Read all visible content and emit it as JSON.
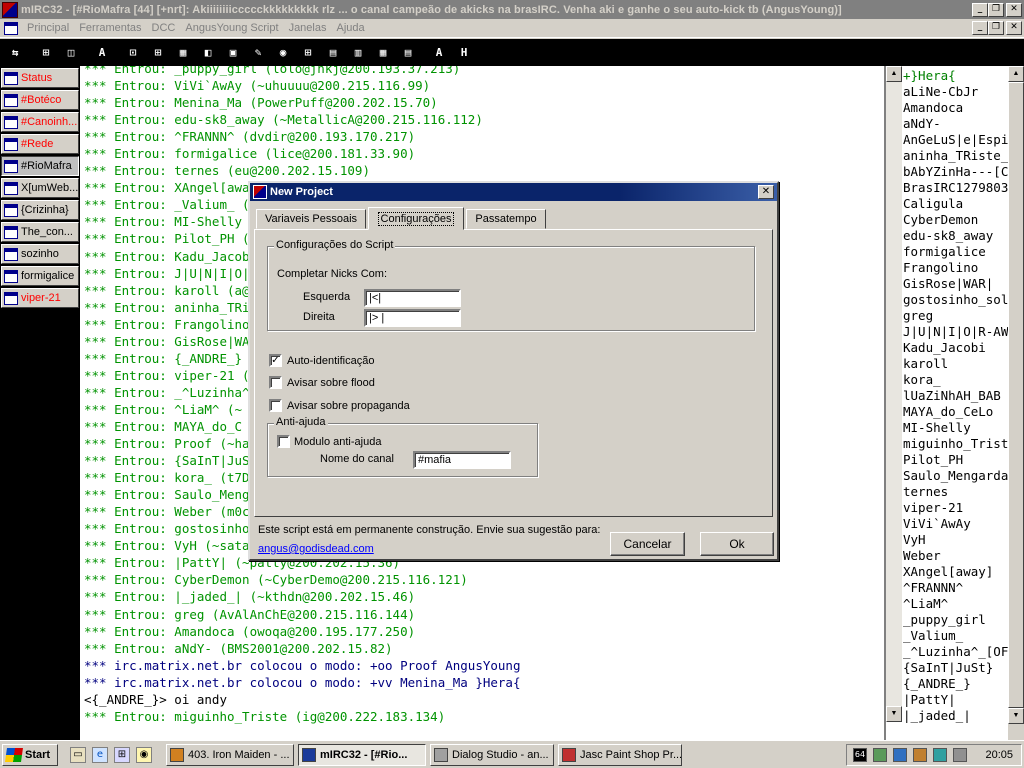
{
  "window": {
    "title": "mIRC32 - [#RioMafra [44] [+nrt]: Akiiiiiiiiccccckkkkkkkkk rlz ... o canal campeão de akicks na brasIRC. Venha aki e ganhe o seu auto-kick tb (AngusYoung)]"
  },
  "menu": {
    "items": [
      "Principal",
      "Ferramentas",
      "DCC",
      "AngusYoung Script",
      "Janelas",
      "Ajuda"
    ]
  },
  "toolbar": {
    "buttons": [
      "⇆",
      "⊞",
      "◫",
      "A",
      "⊡",
      "⊞",
      "▦",
      "◧",
      "▣",
      "✎",
      "◉",
      "⊞",
      "▤",
      "▥",
      "▦",
      "▤",
      "A",
      "H"
    ]
  },
  "switchbar": {
    "items": [
      {
        "label": "Status",
        "color": "#ff0000"
      },
      {
        "label": "#Botéco",
        "color": "#ff0000"
      },
      {
        "label": "#Canoinh...",
        "color": "#ff0000"
      },
      {
        "label": "#Rede",
        "color": "#ff0000"
      },
      {
        "label": "#RioMafra",
        "color": "#000000"
      },
      {
        "label": "X[umWeb...",
        "color": "#000000"
      },
      {
        "label": "{Crizinha}",
        "color": "#000000"
      },
      {
        "label": "The_con...",
        "color": "#000000"
      },
      {
        "label": "sozinho",
        "color": "#000000"
      },
      {
        "label": "formigalice",
        "color": "#000000"
      },
      {
        "label": "viper-21",
        "color": "#ff0000"
      }
    ]
  },
  "chat": {
    "lines": [
      {
        "type": "join",
        "text": "*** Entrou: _puppy_girl (lolo@jnkj@200.193.37.213)"
      },
      {
        "type": "join",
        "text": "*** Entrou: ViVi`AwAy (~uhuuuu@200.215.116.99)"
      },
      {
        "type": "join",
        "text": "*** Entrou: Menina_Ma (PowerPuff@200.202.15.70)"
      },
      {
        "type": "join",
        "text": "*** Entrou: edu-sk8_away (~MetallicA@200.215.116.112)"
      },
      {
        "type": "join",
        "text": "*** Entrou: ^FRANNN^ (dvdir@200.193.170.217)"
      },
      {
        "type": "join",
        "text": "*** Entrou: formigalice (lice@200.181.33.90)"
      },
      {
        "type": "join",
        "text": "*** Entrou: ternes (eu@200.202.15.109)"
      },
      {
        "type": "join",
        "text": "*** Entrou: XAngel[away]"
      },
      {
        "type": "join",
        "text": "*** Entrou: _Valium_ (k"
      },
      {
        "type": "join",
        "text": "*** Entrou: MI-Shelly (l"
      },
      {
        "type": "join",
        "text": "*** Entrou: Pilot_PH (uk"
      },
      {
        "type": "join",
        "text": "*** Entrou: Kadu_Jacob"
      },
      {
        "type": "join",
        "text": "*** Entrou: J|U|N|I|O|"
      },
      {
        "type": "join",
        "text": "*** Entrou: karoll (a@2"
      },
      {
        "type": "join",
        "text": "*** Entrou: aninha_TRis"
      },
      {
        "type": "join",
        "text": "*** Entrou: Frangolino ("
      },
      {
        "type": "join",
        "text": "*** Entrou: GisRose|WA"
      },
      {
        "type": "join",
        "text": "*** Entrou: {_ANDRE_}"
      },
      {
        "type": "join",
        "text": "*** Entrou: viper-21 (~"
      },
      {
        "type": "join",
        "text": "*** Entrou: _^Luzinha^"
      },
      {
        "type": "join",
        "text": "*** Entrou: ^LiaM^ (~"
      },
      {
        "type": "join",
        "text": "*** Entrou: MAYA_do_C"
      },
      {
        "type": "join",
        "text": "*** Entrou: Proof (~has"
      },
      {
        "type": "join",
        "text": "*** Entrou: {SaInT|JuS"
      },
      {
        "type": "join",
        "text": "*** Entrou: kora_ (t7DS"
      },
      {
        "type": "join",
        "text": "*** Entrou: Saulo_Meng"
      },
      {
        "type": "join",
        "text": "*** Entrou: Weber (m0c"
      },
      {
        "type": "join",
        "text": "*** Entrou: gostosinho_"
      },
      {
        "type": "join",
        "text": "*** Entrou: VyH (~sata"
      },
      {
        "type": "join",
        "text": "*** Entrou: |PattY| (~patty@200.202.15.36)"
      },
      {
        "type": "join",
        "text": "*** Entrou: CyberDemon (~CyberDemo@200.215.116.121)"
      },
      {
        "type": "join",
        "text": "*** Entrou: |_jaded_| (~kthdn@200.202.15.46)"
      },
      {
        "type": "join",
        "text": "*** Entrou: greg (AvAlAnChE@200.215.116.144)"
      },
      {
        "type": "join",
        "text": "*** Entrou: Amandoca (owoqa@200.195.177.250)"
      },
      {
        "type": "join",
        "text": "*** Entrou: aNdY- (BMS2001@200.202.15.82)"
      },
      {
        "type": "mode",
        "text": "*** irc.matrix.net.br colocou o modo: +oo Proof AngusYoung"
      },
      {
        "type": "mode",
        "text": "*** irc.matrix.net.br colocou o modo: +vv Menina_Ma }Hera{"
      },
      {
        "type": "msg",
        "text": "<{_ANDRE_}> oi andy"
      },
      {
        "type": "join",
        "text": "*** Entrou: miguinho_Triste (ig@200.222.183.134)"
      }
    ]
  },
  "nicklist": {
    "items": [
      {
        "nick": "+}Hera{",
        "op": true
      },
      {
        "nick": "aLiNe-CbJr"
      },
      {
        "nick": "Amandoca"
      },
      {
        "nick": "aNdY-"
      },
      {
        "nick": "AnGeLuS|e|Espi"
      },
      {
        "nick": "aninha_TRiste_n"
      },
      {
        "nick": "bAbYZinHa---[C"
      },
      {
        "nick": "BrasIRC1279803"
      },
      {
        "nick": "Caligula"
      },
      {
        "nick": "CyberDemon"
      },
      {
        "nick": "edu-sk8_away"
      },
      {
        "nick": "formigalice"
      },
      {
        "nick": "Frangolino"
      },
      {
        "nick": "GisRose|WAR|"
      },
      {
        "nick": "gostosinho_solte"
      },
      {
        "nick": "greg"
      },
      {
        "nick": "J|U|N|I|O|R-AW"
      },
      {
        "nick": "Kadu_Jacobi"
      },
      {
        "nick": "karoll"
      },
      {
        "nick": "kora_"
      },
      {
        "nick": "lUaZiNhAH_BAB"
      },
      {
        "nick": "MAYA_do_CeLo"
      },
      {
        "nick": "MI-Shelly"
      },
      {
        "nick": "miguinho_Triste"
      },
      {
        "nick": "Pilot_PH"
      },
      {
        "nick": "Saulo_Mengarda"
      },
      {
        "nick": "ternes"
      },
      {
        "nick": "viper-21"
      },
      {
        "nick": "ViVi`AwAy"
      },
      {
        "nick": "VyH"
      },
      {
        "nick": "Weber"
      },
      {
        "nick": "XAngel[away]"
      },
      {
        "nick": "^FRANNN^"
      },
      {
        "nick": "^LiaM^"
      },
      {
        "nick": "_puppy_girl"
      },
      {
        "nick": "_Valium_"
      },
      {
        "nick": "_^Luzinha^_[OF"
      },
      {
        "nick": "{SaInT|JuSt}"
      },
      {
        "nick": "{_ANDRE_}"
      },
      {
        "nick": "|PattY|"
      },
      {
        "nick": "|_jaded_|"
      }
    ]
  },
  "dialog": {
    "title": "New Project",
    "tabs": [
      "Variaveis Pessoais",
      "Configurações",
      "Passatempo"
    ],
    "active_tab": "Configurações",
    "group_script": "Configurações do Script",
    "completar_label": "Completar Nicks Com:",
    "esquerda_label": "Esquerda",
    "esquerda_value": "|<|",
    "direita_label": "Direita",
    "direita_value": "|> |",
    "auto_ident_label": "Auto-identificação",
    "auto_ident_checked": true,
    "flood_label": "Avisar sobre flood",
    "flood_checked": false,
    "propaganda_label": "Avisar sobre propaganda",
    "propaganda_checked": false,
    "group_antiajuda": "Anti-ajuda",
    "modulo_label": "Modulo anti-ajuda",
    "modulo_checked": false,
    "canal_label": "Nome do canal",
    "canal_value": "#mafia",
    "footer_text": "Este script está em permanente construção. Envie sua sugestão para:",
    "email": "angus@godisdead.com",
    "cancel_label": "Cancelar",
    "ok_label": "Ok"
  },
  "taskbar": {
    "start_label": "Start",
    "tasks": [
      {
        "label": "403. Iron Maiden - ...",
        "active": false
      },
      {
        "label": "mIRC32 - [#Rio...",
        "active": true
      },
      {
        "label": "Dialog Studio - an...",
        "active": false
      },
      {
        "label": "Jasc Paint Shop Pr...",
        "active": false
      }
    ],
    "tray_badge": "64",
    "clock": "20:05"
  }
}
